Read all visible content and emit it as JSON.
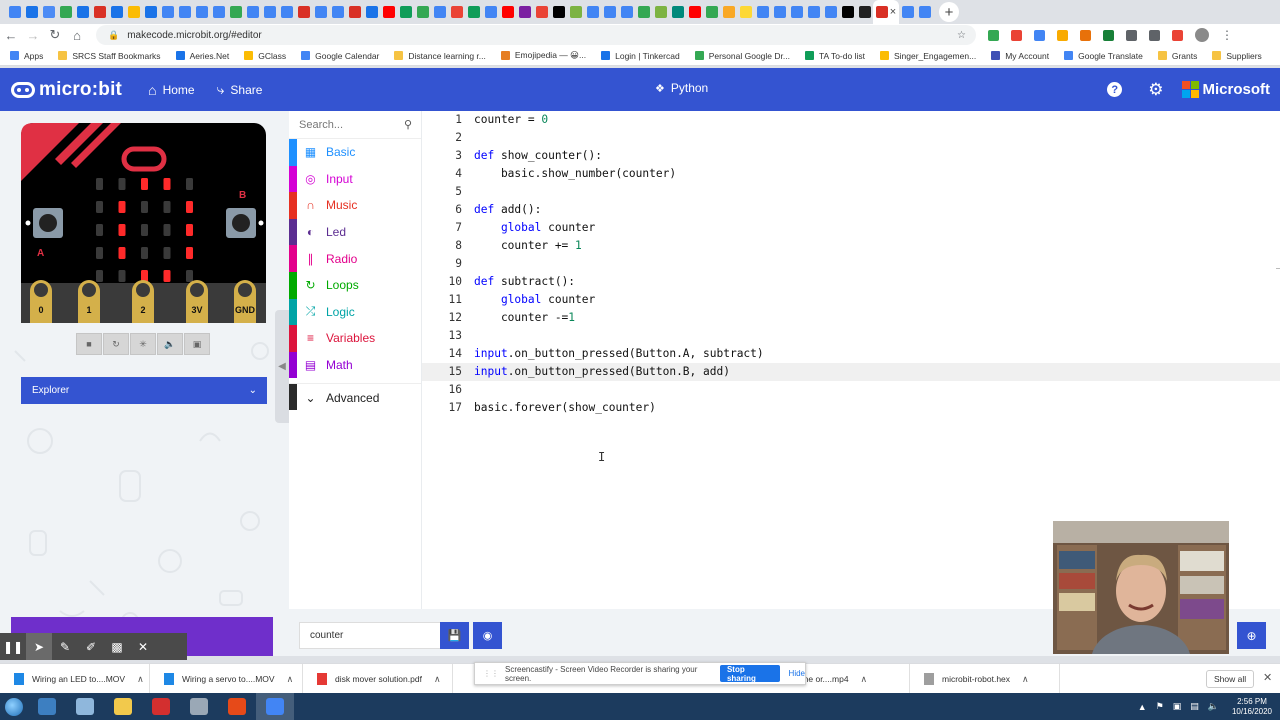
{
  "browser": {
    "favicon_colors": [
      "#4285f4",
      "#1a73e8",
      "#4c8bf5",
      "#34a853",
      "#1a73e8",
      "#d93025",
      "#1a73e8",
      "#fbbc04",
      "#1a73e8",
      "#4285f4",
      "#4285f4",
      "#4285f4",
      "#4285f4",
      "#34a853",
      "#4285f4",
      "#4285f4",
      "#4285f4",
      "#d93025",
      "#4285f4",
      "#4285f4",
      "#d93025",
      "#1a73e8",
      "#ff0000",
      "#0f9d58",
      "#34a853",
      "#4285f4",
      "#ea4335",
      "#0f9d58",
      "#4285f4",
      "#ff0000",
      "#7b1fa2",
      "#ea4335",
      "#000000",
      "#7cb342",
      "#4285f4",
      "#4285f4",
      "#4285f4",
      "#34a853",
      "#7cb342",
      "#00897b",
      "#ff0000",
      "#34a853",
      "#f9a825",
      "#fdd835",
      "#4285f4",
      "#4285f4",
      "#4285f4",
      "#4285f4",
      "#4285f4",
      "#000000",
      "#212121",
      "#d93025",
      "#4285f4",
      "#4285f4"
    ],
    "active_tab_close": "×",
    "url": "makecode.microbit.org/#editor",
    "bookmarks": [
      {
        "label": "Apps",
        "color": "#4285f4"
      },
      {
        "label": "SRCS Staff Bookmarks",
        "color": "folder"
      },
      {
        "label": "Aeries.Net",
        "color": "#1a73e8"
      },
      {
        "label": "GClass",
        "color": "#fbbc04"
      },
      {
        "label": "Google Calendar",
        "color": "#4285f4"
      },
      {
        "label": "Distance learning r...",
        "color": "folder"
      },
      {
        "label": "Emojipedia — 😀...",
        "color": "#e67e22"
      },
      {
        "label": "Login | Tinkercad",
        "color": "#1a73e8"
      },
      {
        "label": "Personal Google Dr...",
        "color": "#34a853"
      },
      {
        "label": "TA To-do list",
        "color": "#0f9d58"
      },
      {
        "label": "Singer_Engagemen...",
        "color": "#fbbc04"
      },
      {
        "label": "My Account",
        "color": "#3f51b5"
      },
      {
        "label": "Google Translate",
        "color": "#4285f4"
      },
      {
        "label": "Grants",
        "color": "folder"
      },
      {
        "label": "Suppliers",
        "color": "folder"
      }
    ]
  },
  "header": {
    "brand": "micro:bit",
    "home_label": "Home",
    "share_label": "Share",
    "language_label": "Python",
    "help_icon": "?",
    "company": "Microsoft",
    "accent_color": "#3454d1"
  },
  "simulator": {
    "pins": [
      "0",
      "1",
      "2",
      "3V",
      "GND"
    ],
    "button_a": "A",
    "button_b": "B",
    "lit_leds": [
      [
        0,
        2
      ],
      [
        0,
        3
      ],
      [
        1,
        1
      ],
      [
        1,
        4
      ],
      [
        2,
        1
      ],
      [
        2,
        4
      ],
      [
        3,
        1
      ],
      [
        3,
        4
      ],
      [
        4,
        2
      ],
      [
        4,
        3
      ]
    ],
    "explorer_label": "Explorer"
  },
  "toolbox": {
    "search_placeholder": "Search...",
    "categories": [
      {
        "label": "Basic",
        "color": "#1e90ff",
        "icon": "grid-icon"
      },
      {
        "label": "Input",
        "color": "#d400d4",
        "icon": "target-icon"
      },
      {
        "label": "Music",
        "color": "#e63022",
        "icon": "headphones-icon"
      },
      {
        "label": "Led",
        "color": "#5c2d91",
        "icon": "toggle-icon"
      },
      {
        "label": "Radio",
        "color": "#e3008c",
        "icon": "signal-icon"
      },
      {
        "label": "Loops",
        "color": "#00aa00",
        "icon": "refresh-icon"
      },
      {
        "label": "Logic",
        "color": "#00a4a6",
        "icon": "shuffle-icon"
      },
      {
        "label": "Variables",
        "color": "#dc143c",
        "icon": "list-icon"
      },
      {
        "label": "Math",
        "color": "#9400d3",
        "icon": "calculator-icon"
      }
    ],
    "advanced_label": "Advanced"
  },
  "editor": {
    "lines": [
      {
        "n": "1",
        "text": "counter = 0"
      },
      {
        "n": "2",
        "text": ""
      },
      {
        "n": "3",
        "text": "def show_counter():"
      },
      {
        "n": "4",
        "text": "    basic.show_number(counter)"
      },
      {
        "n": "5",
        "text": ""
      },
      {
        "n": "6",
        "text": "def add():"
      },
      {
        "n": "7",
        "text": "    global counter"
      },
      {
        "n": "8",
        "text": "    counter += 1"
      },
      {
        "n": "9",
        "text": ""
      },
      {
        "n": "10",
        "text": "def subtract():"
      },
      {
        "n": "11",
        "text": "    global counter"
      },
      {
        "n": "12",
        "text": "    counter -=1"
      },
      {
        "n": "13",
        "text": ""
      },
      {
        "n": "14",
        "text": "input.on_button_pressed(Button.A, subtract)"
      },
      {
        "n": "15",
        "text": "input.on_button_pressed(Button.B, add)"
      },
      {
        "n": "16",
        "text": ""
      },
      {
        "n": "17",
        "text": "basic.forever(show_counter)"
      }
    ],
    "highlighted_line": "15",
    "keyword_color": "#0000ff",
    "number_color": "#098658"
  },
  "footer": {
    "project_name": "counter"
  },
  "downloads": [
    {
      "label": "Wiring an LED to....MOV",
      "icon_color": "#1e88e5"
    },
    {
      "label": "Wiring a servo to....MOV",
      "icon_color": "#1e88e5"
    },
    {
      "label": "disk mover solution.pdf",
      "icon_color": "#e53935"
    },
    {
      "label": "...ilding the or....mp4",
      "icon_color": "#1e88e5"
    },
    {
      "label": "microbit-robot.hex",
      "icon_color": "#9e9e9e"
    }
  ],
  "downloads_show_all": "Show all",
  "share_banner": {
    "text": "Screencastify - Screen Video Recorder is sharing your screen.",
    "stop_label": "Stop sharing",
    "hide_label": "Hide"
  },
  "taskbar": {
    "apps": [
      "#3d7fc1",
      "#8fb7dc",
      "#f2c94c",
      "#d32f2f",
      "#9aa8b6",
      "#e64a19",
      "#4285f4"
    ],
    "time": "2:56 PM",
    "date": "10/16/2020"
  }
}
